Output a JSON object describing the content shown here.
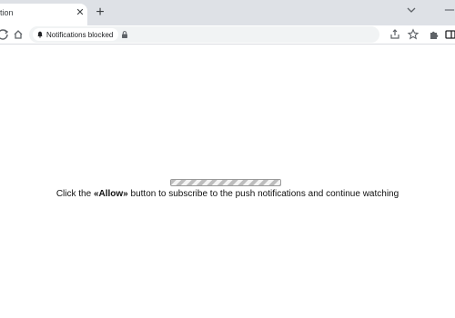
{
  "tab": {
    "title": "tion",
    "close_glyph": "✕",
    "new_tab_glyph": "+"
  },
  "omnibox": {
    "permission_chip": "Notifications blocked"
  },
  "page": {
    "progress": 1.0,
    "message_prefix": "Click the ",
    "message_bold": "«Allow»",
    "message_suffix": " button to subscribe to the push notifications and continue watching"
  },
  "icons": [
    "chevron-down-icon",
    "minimize-icon",
    "reload-icon",
    "home-icon",
    "bell-icon",
    "lock-icon",
    "share-icon",
    "bookmark-star-icon",
    "extensions-icon",
    "side-panel-icon"
  ]
}
